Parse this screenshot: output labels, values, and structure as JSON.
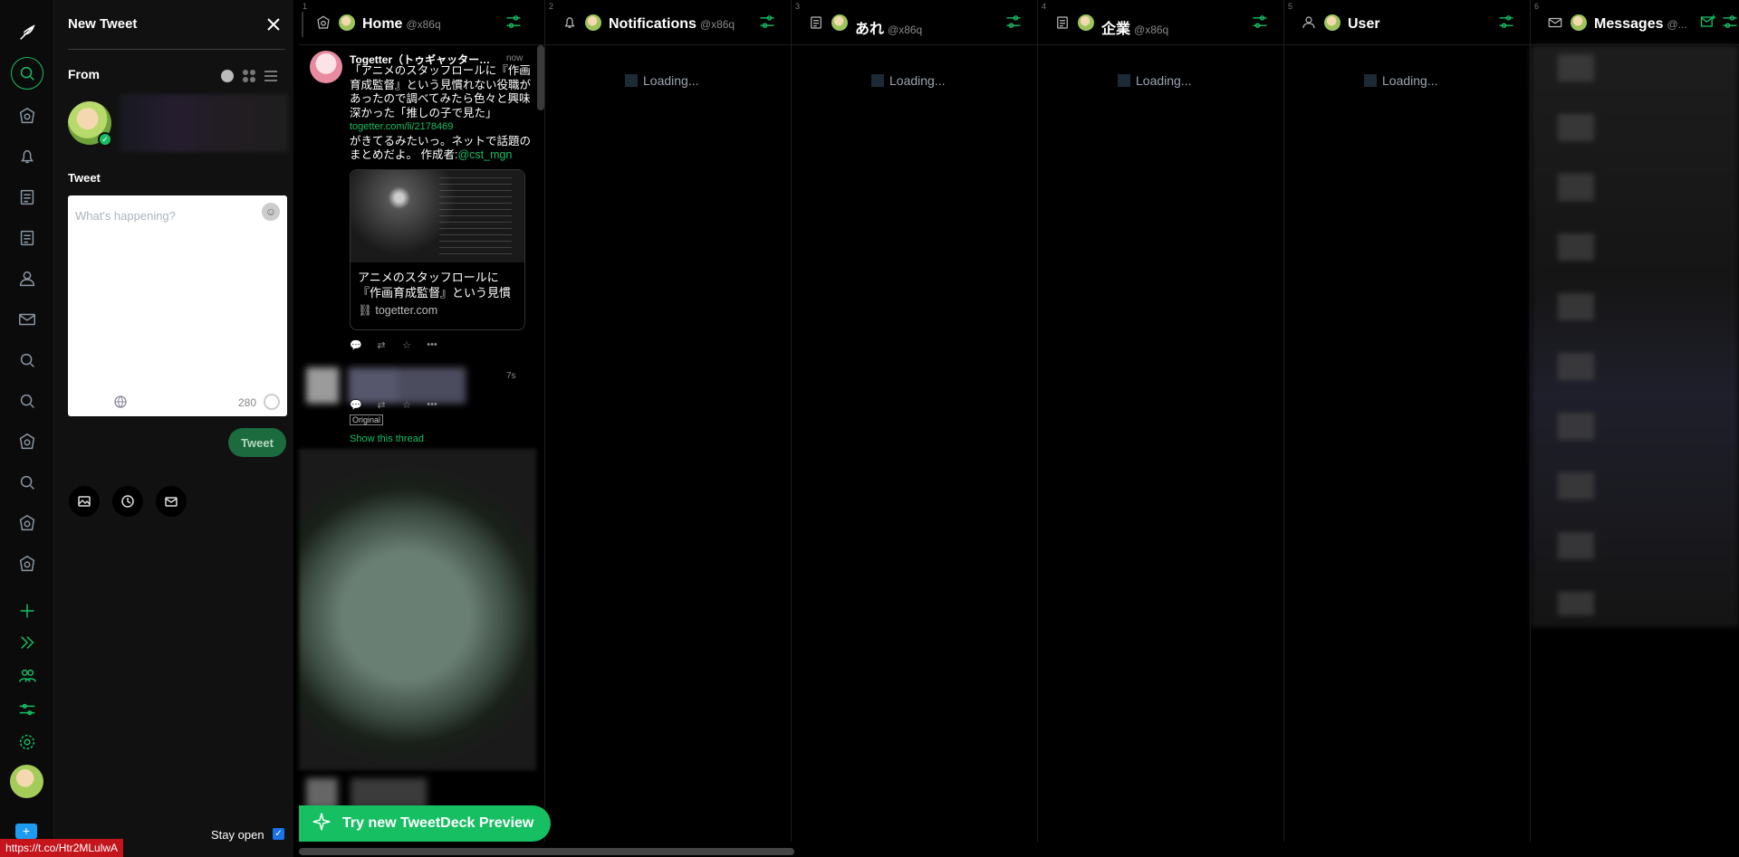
{
  "app": {
    "brand_icon": "tweetdeck-logo"
  },
  "nav": {
    "items": [
      {
        "name": "search-icon",
        "icon": "search"
      },
      {
        "name": "home-icon",
        "icon": "home"
      },
      {
        "name": "bell-icon",
        "icon": "bell"
      },
      {
        "name": "list-icon",
        "icon": "list"
      },
      {
        "name": "list-icon",
        "icon": "list"
      },
      {
        "name": "user-icon",
        "icon": "user"
      },
      {
        "name": "mail-icon",
        "icon": "mail"
      },
      {
        "name": "search-icon",
        "icon": "search"
      },
      {
        "name": "search-icon",
        "icon": "search"
      },
      {
        "name": "home-icon",
        "icon": "home"
      },
      {
        "name": "search-icon",
        "icon": "search"
      },
      {
        "name": "home-icon",
        "icon": "home"
      },
      {
        "name": "home-icon",
        "icon": "home"
      }
    ],
    "add_column": "+",
    "accent": "#17bf63"
  },
  "compose": {
    "title": "New Tweet",
    "from_label": "From",
    "tweet_label": "Tweet",
    "placeholder": "What's happening?",
    "char_count": "280",
    "tweet_button": "Tweet",
    "stay_open": "Stay open"
  },
  "columns": [
    {
      "num": "1",
      "title": "Home",
      "handle": "@x86q",
      "icon": "home"
    },
    {
      "num": "2",
      "title": "Notifications",
      "handle": "@x86q",
      "icon": "bell",
      "loading": "Loading..."
    },
    {
      "num": "3",
      "title": "あれ",
      "handle": "@x86q",
      "icon": "list",
      "loading": "Loading..."
    },
    {
      "num": "4",
      "title": "企業",
      "handle": "@x86q",
      "icon": "list",
      "loading": "Loading..."
    },
    {
      "num": "5",
      "title": "User",
      "handle": "",
      "icon": "user",
      "loading": "Loading..."
    },
    {
      "num": "6",
      "title": "Messages",
      "handle": "@...",
      "icon": "mail"
    }
  ],
  "tweet": {
    "name": "Togetter（トゥギャッター）...",
    "time": "now",
    "text": "「アニメのスタッフロールに『作画育成監督』という見慣れない役職があったので調べてみたら色々と興味深かった「推しの子で見た」",
    "link": "togetter.com/li/2178469",
    "text2": "がきてるみたいっ。ネットで話題のまとめだよ。 作成者:",
    "mention": "@cst_mgn",
    "card_title": "アニメのスタッフロールに『作画育成監督』という見慣れない役...",
    "card_domain": "togetter.com",
    "second_time": "7s",
    "original_badge": "Original",
    "show_thread": "Show this thread"
  },
  "banner": {
    "label": "Try new TweetDeck Preview"
  },
  "status_url": "https://t.co/Htr2MLulwA"
}
